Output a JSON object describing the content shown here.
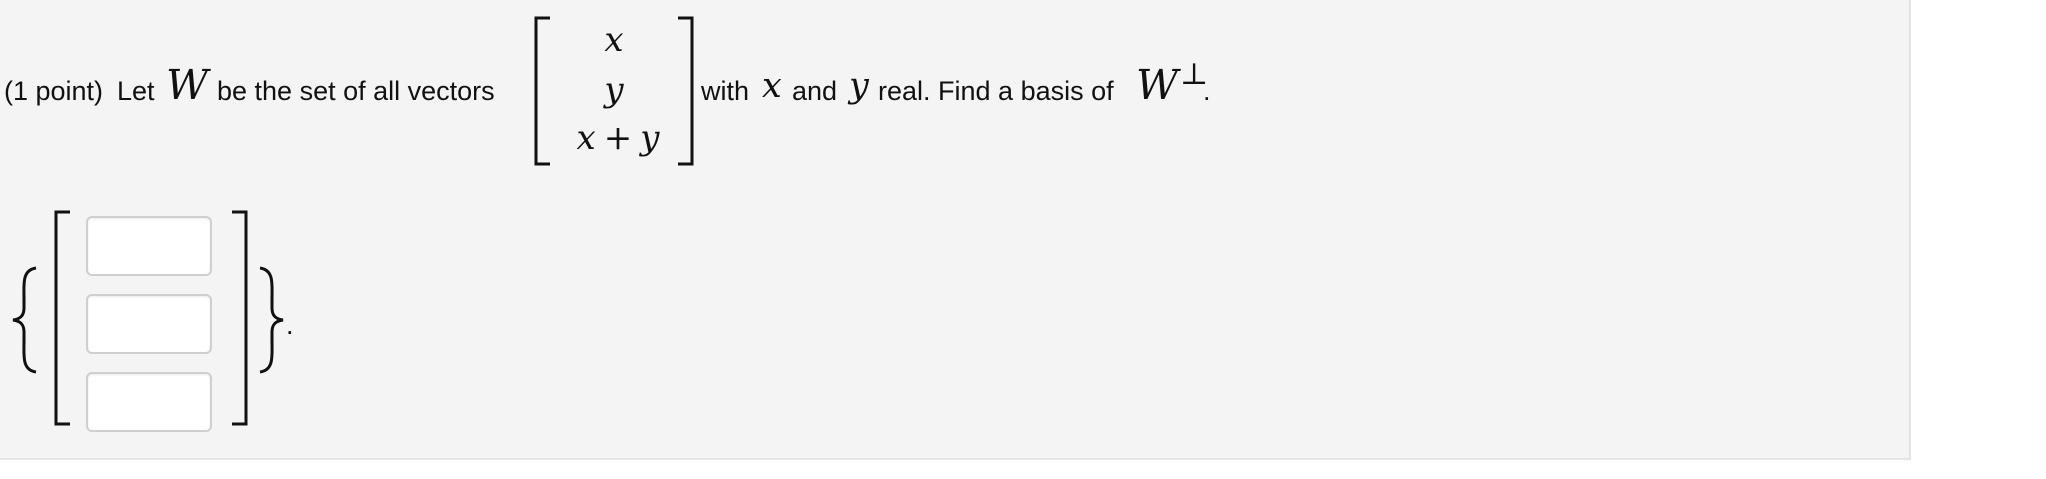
{
  "problem": {
    "points": "(1 point)",
    "let_text": "Let",
    "var_W": "W",
    "be_text": "be the set of all vectors",
    "vector": {
      "entry_1": "x",
      "entry_2": "y",
      "entry_3_a": "x",
      "entry_3_op": "+",
      "entry_3_b": "y"
    },
    "with_text": "with",
    "var_x": "x",
    "and_text": "and",
    "var_y": "y",
    "real_text": "real. Find a basis of",
    "var_W2": "W",
    "perp_symbol": "⊥",
    "period": "."
  },
  "answer": {
    "inputs": [
      {
        "value": ""
      },
      {
        "value": ""
      },
      {
        "value": ""
      }
    ],
    "period": "."
  }
}
